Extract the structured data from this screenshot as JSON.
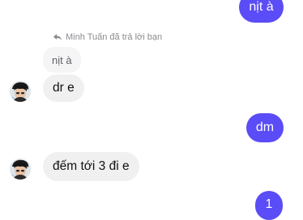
{
  "conversation": {
    "messages": [
      {
        "direction": "outgoing",
        "text": "nịt à"
      },
      {
        "direction": "incoming",
        "reply_label": "Minh Tuấn đã trả lời bạn",
        "quoted_text": "nịt à",
        "text": "dr e"
      },
      {
        "direction": "outgoing",
        "text": "dm"
      },
      {
        "direction": "incoming",
        "text": "đếm tới 3 đi e"
      },
      {
        "direction": "outgoing",
        "text": "1"
      }
    ]
  },
  "colors": {
    "outgoing_bubble": "#5a4cf6",
    "incoming_bubble": "#f0f0f0",
    "reply_text": "#8b8b90"
  },
  "icons": {
    "reply": "reply-arrow-icon",
    "avatar": "user-avatar"
  }
}
